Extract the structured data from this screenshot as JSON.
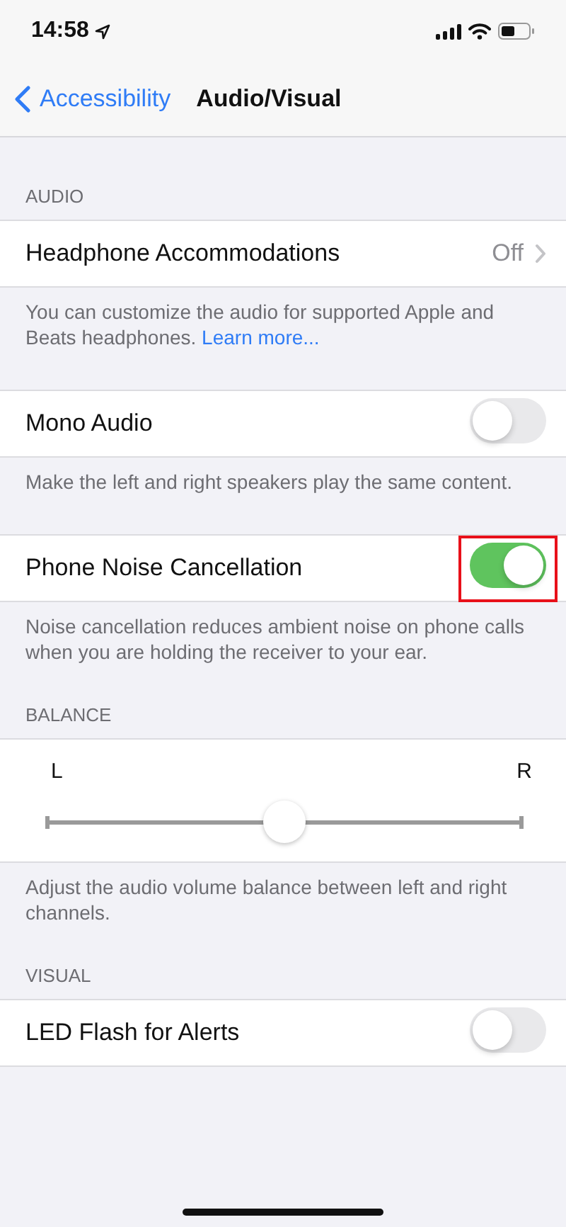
{
  "status_bar": {
    "time": "14:58"
  },
  "nav": {
    "back": "Accessibility",
    "title": "Audio/Visual"
  },
  "sections": [
    {
      "header": "AUDIO",
      "rows": [
        {
          "kind": "disclosure",
          "label": "Headphone Accommodations",
          "value": "Off"
        }
      ],
      "footer": {
        "text": "You can customize the audio for supported Apple and Beats headphones.",
        "link": "Learn more..."
      }
    },
    {
      "rows": [
        {
          "kind": "toggle",
          "label": "Mono Audio",
          "on": false,
          "highlighted": false
        }
      ],
      "footer": {
        "text": "Make the left and right speakers play the same content."
      }
    },
    {
      "rows": [
        {
          "kind": "toggle",
          "label": "Phone Noise Cancellation",
          "on": true,
          "highlighted": true
        }
      ],
      "footer": {
        "text": "Noise cancellation reduces ambient noise on phone calls when you are holding the receiver to your ear."
      }
    },
    {
      "header": "BALANCE",
      "rows": [
        {
          "kind": "slider",
          "left": "L",
          "right": "R",
          "level": 0.5
        }
      ],
      "footer": {
        "text": "Adjust the audio volume balance between left and right channels."
      }
    },
    {
      "header": "VISUAL",
      "rows": [
        {
          "kind": "toggle",
          "label": "LED Flash for Alerts",
          "on": false,
          "highlighted": false
        }
      ]
    }
  ]
}
